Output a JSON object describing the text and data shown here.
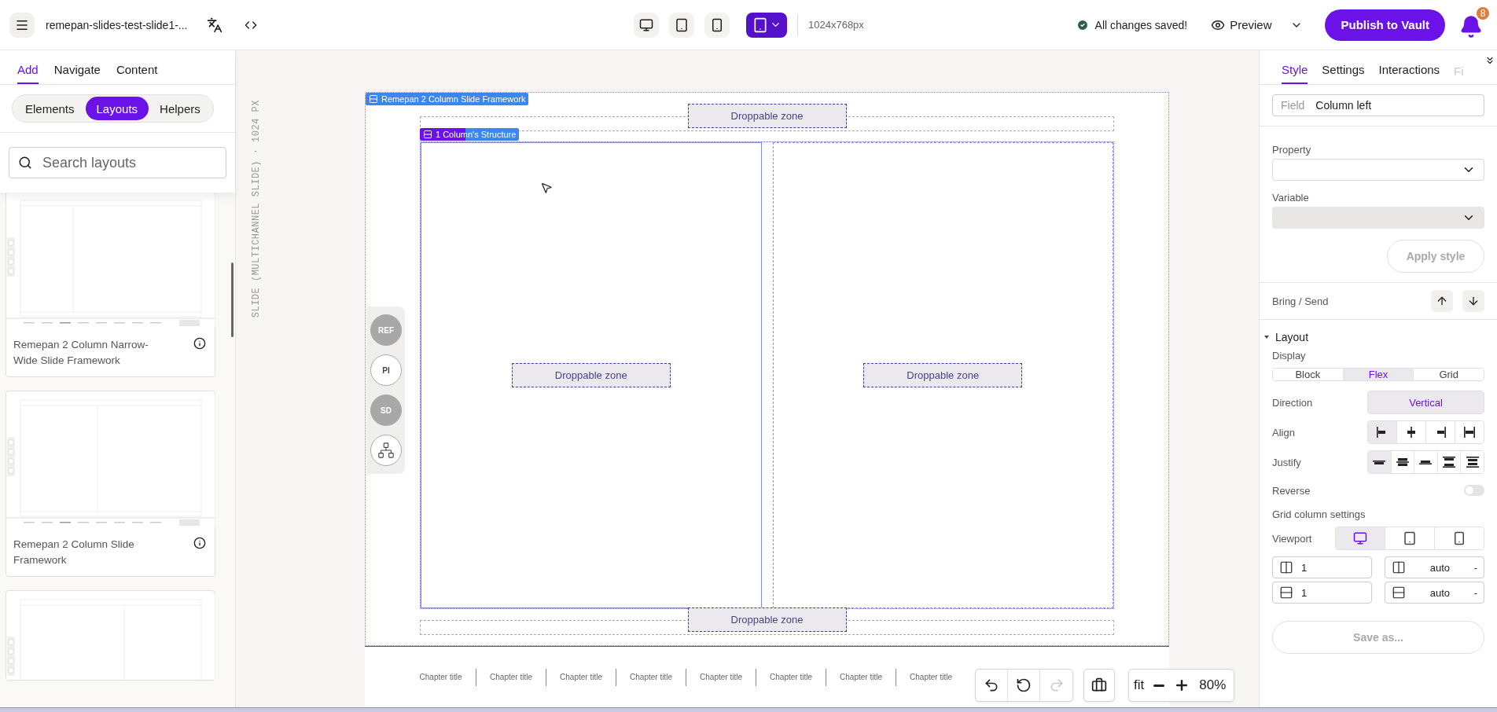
{
  "topbar": {
    "title": "remepan-slides-test-slide1-...",
    "devices": [
      {
        "kind": "desktop",
        "selected": false
      },
      {
        "kind": "tablet",
        "selected": false
      },
      {
        "kind": "phone",
        "selected": false
      }
    ],
    "device_dropdown": {
      "kind": "tablet"
    },
    "resolution": "1024x768px",
    "save_status": "All changes saved!",
    "preview": "Preview",
    "publish": "Publish to Vault",
    "notifications": "8"
  },
  "left_panel": {
    "tabs": [
      {
        "label": "Add",
        "selected": true
      },
      {
        "label": "Navigate",
        "selected": false
      },
      {
        "label": "Content",
        "selected": false
      }
    ],
    "segments": [
      {
        "label": "Elements",
        "selected": false
      },
      {
        "label": "Layouts",
        "selected": true
      },
      {
        "label": "Helpers",
        "selected": false
      }
    ],
    "search": {
      "placeholder": "Search layouts"
    },
    "cards": [
      {
        "kind": "narrow-wide",
        "title": "Remepan 2 Column Narrow-Wide Slide Framework"
      },
      {
        "kind": "equal",
        "title": "Remepan 2 Column Slide Framework"
      },
      {
        "kind": "wide-narrow"
      }
    ]
  },
  "canvas": {
    "caption": "SLIDE (MULTICHANNEL SLIDE) · 1024 PX",
    "slide": {
      "frame_label": "Remepan 2 Column Slide Framework",
      "structure_label": "1 Column's Structure",
      "top_zone": "Droppable zone",
      "columns": [
        {
          "zone": "Droppable zone",
          "selected": true
        },
        {
          "zone": "Droppable zone",
          "selected": false
        }
      ],
      "bottom_zone": "Droppable zone"
    },
    "side_tools": [
      {
        "kind": "badge",
        "label": "REF",
        "disabled": true
      },
      {
        "kind": "badge",
        "label": "PI",
        "disabled": false
      },
      {
        "kind": "badge",
        "label": "SD",
        "disabled": true
      },
      {
        "kind": "hierarchy",
        "disabled": false
      }
    ],
    "chapters": [
      "Chapter title",
      "Chapter title",
      "Chapter title",
      "Chapter title",
      "Chapter title",
      "Chapter title",
      "Chapter title",
      "Chapter title"
    ],
    "history": [
      {
        "kind": "undo",
        "disabled": false
      },
      {
        "kind": "reset",
        "disabled": false
      },
      {
        "kind": "redo",
        "disabled": true
      }
    ],
    "zoom": {
      "fit": "fit",
      "level_text": "80%"
    }
  },
  "right_panel": {
    "tabs": [
      {
        "label": "Style",
        "selected": true
      },
      {
        "label": "Settings",
        "selected": false
      },
      {
        "label": "Interactions",
        "selected": false
      },
      {
        "label": "Fi",
        "selected": false
      }
    ],
    "field": {
      "label": "Field",
      "value": "Column left"
    },
    "property": {
      "label": "Property"
    },
    "variable": {
      "label": "Variable",
      "disabled": true
    },
    "apply": {
      "label": "Apply style",
      "disabled": true
    },
    "bring_send": "Bring / Send",
    "layout": {
      "title": "Layout",
      "expanded": true
    },
    "display": {
      "label": "Display",
      "options": [
        {
          "label": "Block",
          "selected": false
        },
        {
          "label": "Flex",
          "selected": true
        },
        {
          "label": "Grid",
          "selected": false
        }
      ]
    },
    "direction": {
      "label": "Direction",
      "options": [
        {
          "label": "Vertical",
          "selected": true
        }
      ]
    },
    "align": {
      "label": "Align",
      "options": [
        {
          "kind": "start",
          "selected": true
        },
        {
          "kind": "center",
          "selected": false
        },
        {
          "kind": "end",
          "selected": false
        },
        {
          "kind": "stretch",
          "selected": false
        }
      ]
    },
    "justify": {
      "label": "Justify",
      "options": [
        {
          "kind": "start",
          "selected": true
        },
        {
          "kind": "center",
          "selected": false
        },
        {
          "kind": "end",
          "selected": false
        },
        {
          "kind": "between",
          "selected": false
        },
        {
          "kind": "around",
          "selected": false
        }
      ]
    },
    "reverse": {
      "label": "Reverse",
      "on": false
    },
    "grid_title": "Grid column settings",
    "viewport": {
      "label": "Viewport",
      "options": [
        {
          "kind": "desktop",
          "selected": true
        },
        {
          "kind": "tablet",
          "selected": false
        },
        {
          "kind": "phone",
          "selected": false
        }
      ]
    },
    "grid_inputs": [
      {
        "kind": "columns",
        "value": "1"
      },
      {
        "kind": "columns",
        "value": "auto",
        "suffix": "-"
      },
      {
        "kind": "rows",
        "value": "1"
      },
      {
        "kind": "rows",
        "value": "auto",
        "suffix": "-"
      }
    ],
    "save": {
      "label": "Save as...",
      "disabled": true
    }
  }
}
